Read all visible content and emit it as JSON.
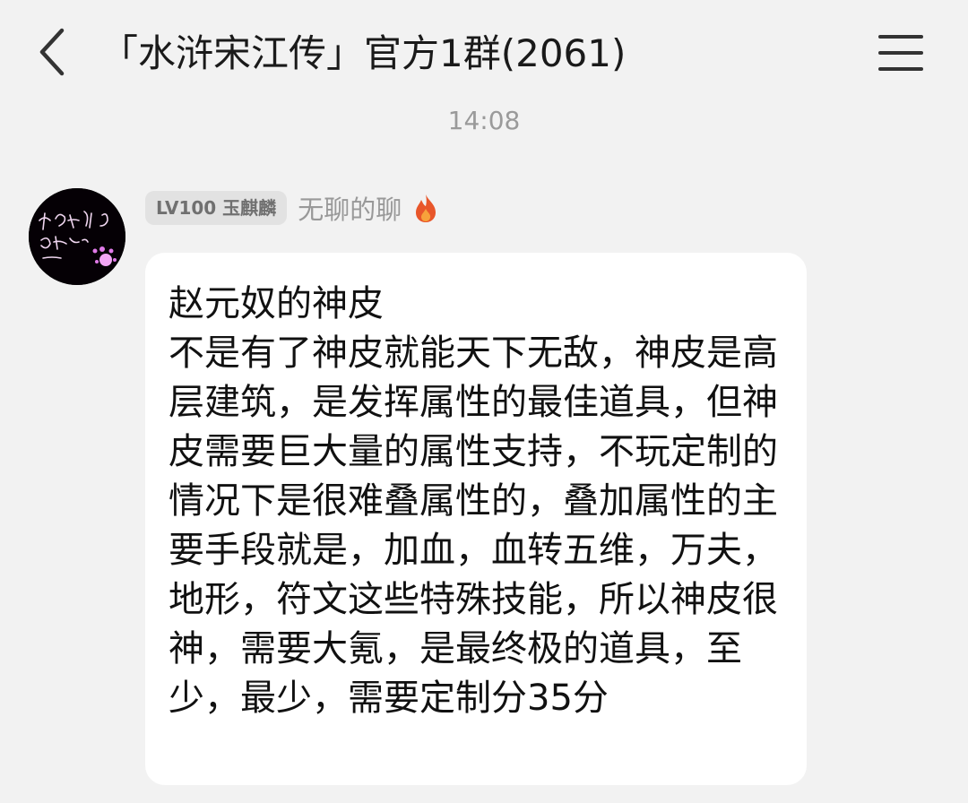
{
  "header": {
    "title": "「水浒宋江传」官方1群(2061)",
    "back_icon": "chevron-left-icon",
    "menu_icon": "hamburger-menu-icon"
  },
  "chat": {
    "timestamp": "14:08",
    "messages": [
      {
        "level_badge": "LV100 玉麒麟",
        "sender": "无聊的聊",
        "status_icon": "fire-icon",
        "text": "赵元奴的神皮\n不是有了神皮就能天下无敌，神皮是高层建筑，是发挥属性的最佳道具，但神皮需要巨大量的属性支持，不玩定制的情况下是很难叠属性的，叠加属性的主要手段就是，加血，血转五维，万夫，地形，符文这些特殊技能，所以神皮很神，需要大氪，是最终极的道具，至少，最少，需要定制分35分"
      }
    ]
  },
  "colors": {
    "background": "#f2f2f2",
    "bubble": "#ffffff",
    "muted_text": "#999999",
    "fire": "#e8562a"
  }
}
